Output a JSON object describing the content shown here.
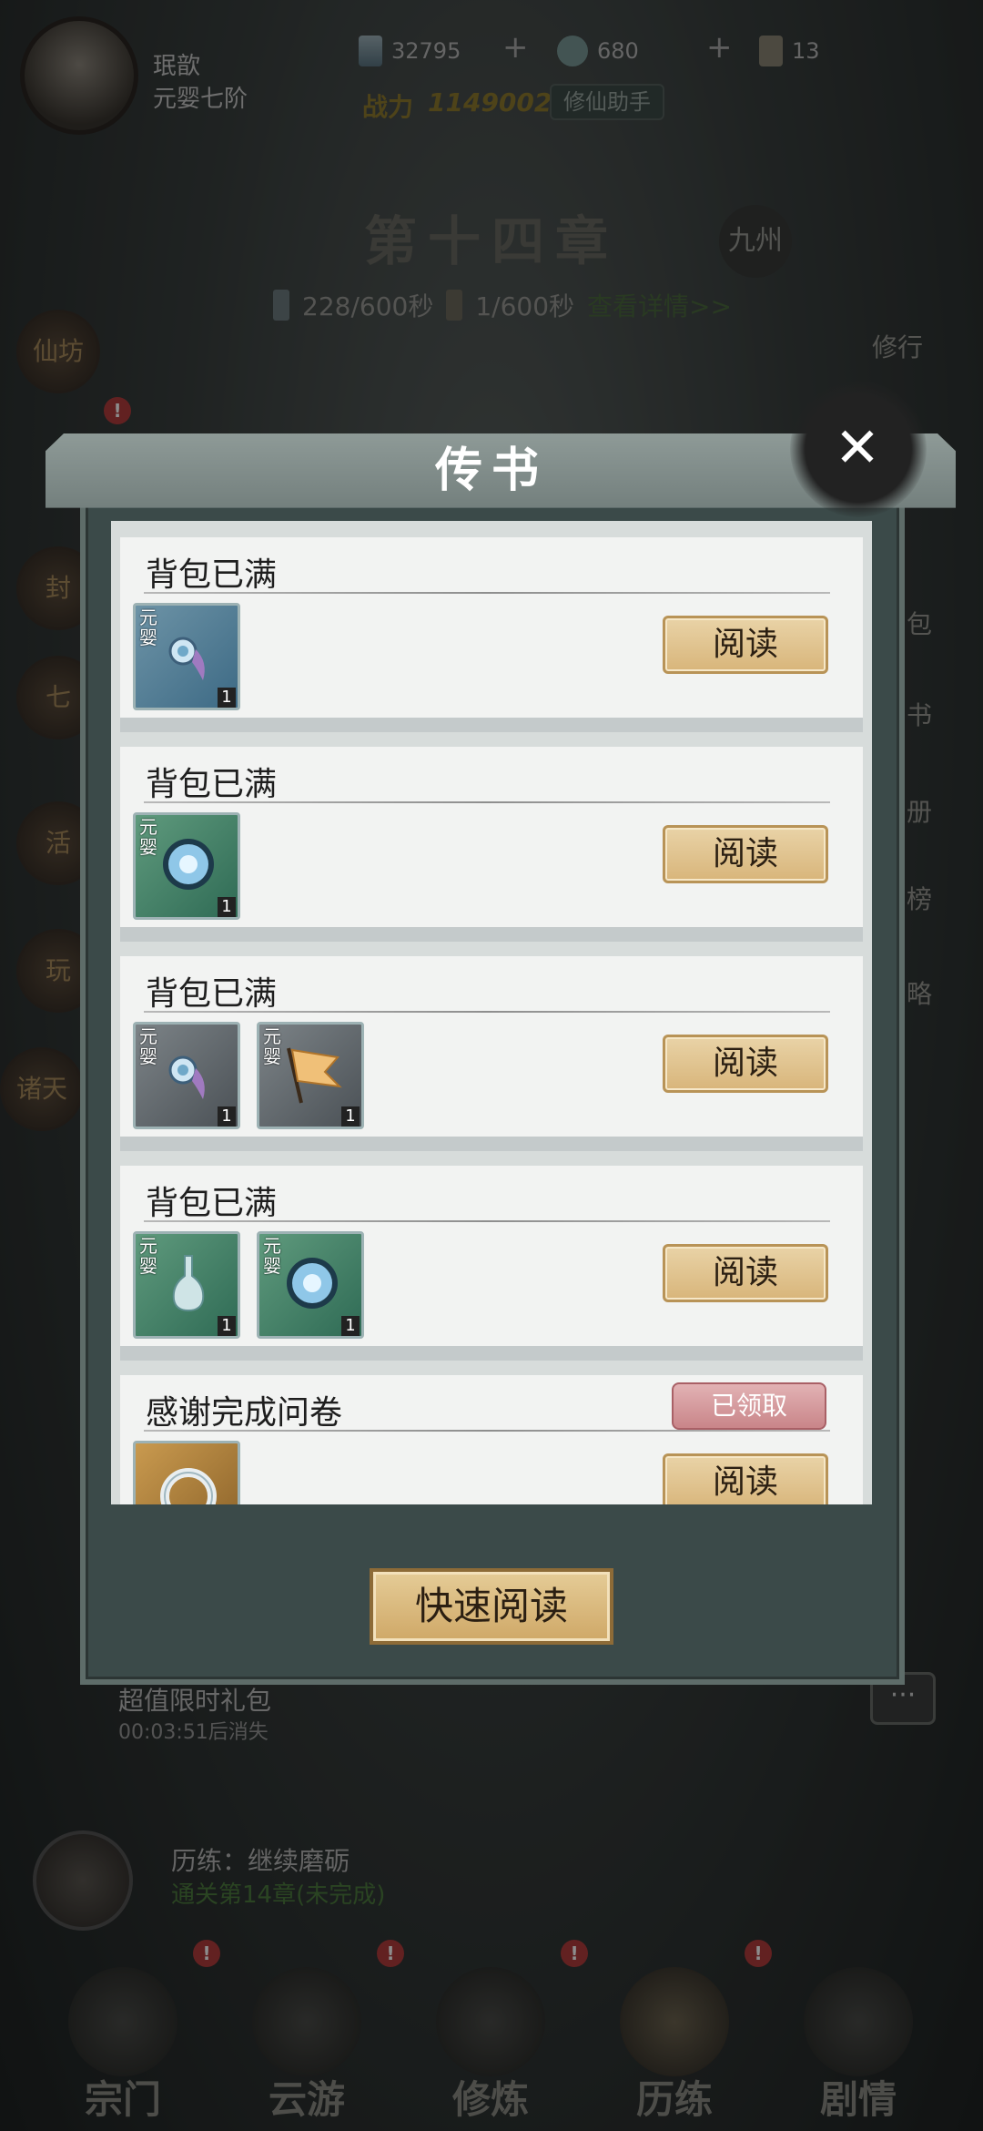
{
  "player": {
    "name": "珉歆",
    "rank": "元婴七阶"
  },
  "resources": [
    {
      "icon": "crystal-icon",
      "value": "32795"
    },
    {
      "icon": "jade-coin-icon",
      "value": "680"
    },
    {
      "icon": "scroll-ticket-icon",
      "value": "13"
    }
  ],
  "power": {
    "label": "战力",
    "value": "1149002"
  },
  "helper_label": "修仙助手",
  "chapter": {
    "title": "第十四章",
    "badge": "九州",
    "timer1": "228/600秒",
    "timer2": "1/600秒",
    "detail_link": "查看详情>>"
  },
  "side_left": [
    "仙坊",
    "封",
    "七",
    "活",
    "玩",
    "诸天"
  ],
  "side_right": [
    "修行",
    "包",
    "书",
    "册",
    "榜",
    "略"
  ],
  "modal": {
    "title": "传书",
    "close_icon": "close-icon",
    "quick_read_label": "快速阅读",
    "read_label": "阅读",
    "claimed_label": "已领取",
    "item_tag": "元婴",
    "letters": [
      {
        "title": "背包已满",
        "items": [
          {
            "kind": "earring-icon",
            "count": "1",
            "bg": "blue"
          }
        ]
      },
      {
        "title": "背包已满",
        "items": [
          {
            "kind": "orb-icon",
            "count": "1",
            "bg": "green"
          }
        ]
      },
      {
        "title": "背包已满",
        "items": [
          {
            "kind": "earring-icon",
            "count": "1",
            "bg": "gray"
          },
          {
            "kind": "banner-icon",
            "count": "1",
            "bg": "gray"
          }
        ]
      },
      {
        "title": "背包已满",
        "items": [
          {
            "kind": "vase-icon",
            "count": "1",
            "bg": "green"
          },
          {
            "kind": "orb-icon",
            "count": "1",
            "bg": "green"
          }
        ]
      },
      {
        "title": "感谢完成问卷",
        "claimed": true,
        "items": [
          {
            "kind": "ring-icon",
            "count": "",
            "bg": "gold"
          }
        ]
      }
    ]
  },
  "promo": {
    "title": "超值限时礼包",
    "subtitle": "00:03:51后消失"
  },
  "training": {
    "title": "历练：继续磨砺",
    "subtitle": "通关第14章(未完成)"
  },
  "bottom_nav": [
    "宗门",
    "云游",
    "修炼",
    "历练",
    "剧情"
  ],
  "colors": {
    "read_button": "#dcb97f",
    "claimed_badge": "#cf8f93",
    "modal_frame": "#5e6c69"
  }
}
